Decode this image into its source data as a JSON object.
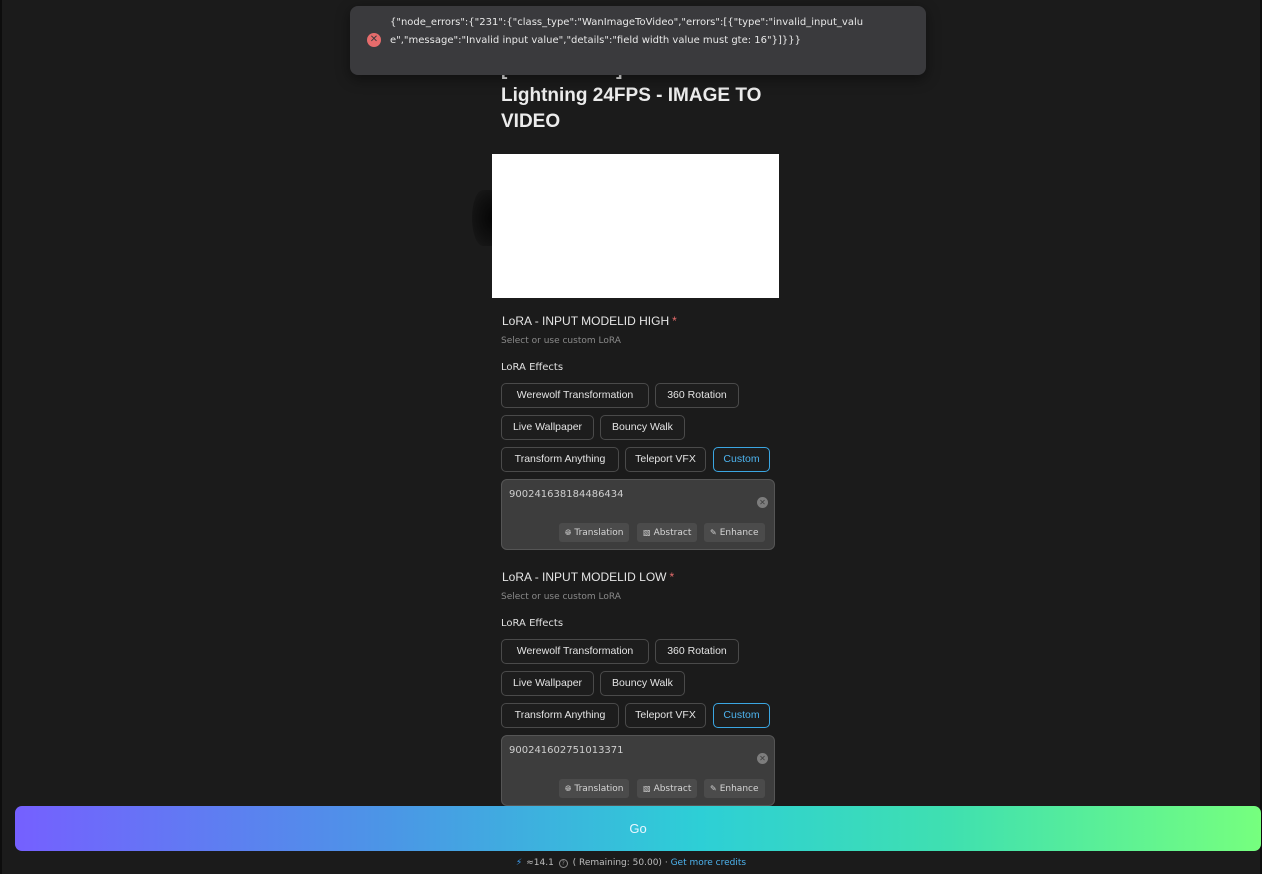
{
  "toast": {
    "icon": "error-circle-icon",
    "message": "{\"node_errors\":{\"231\":{\"class_type\":\"WanImageToVideo\",\"errors\":[{\"type\":\"invalid_input_value\",\"message\":\"Invalid input value\",\"details\":\"field width value must gte: 16\"}]}}}"
  },
  "page": {
    "title": "[FREE USER] WAN2.2 Lightning 24FPS - IMAGE TO VIDEO"
  },
  "lora_high": {
    "title": "LoRA - INPUT MODELID HIGH",
    "required_mark": "*",
    "hint": "Select or use custom LoRA",
    "effects_label": "LoRA Effects",
    "chips": [
      "Werewolf Transformation",
      "360 Rotation",
      "Live Wallpaper",
      "Bouncy Walk",
      "Transform Anything",
      "Teleport VFX",
      "Custom"
    ],
    "active_chip": "Custom",
    "value": "900241638184486434",
    "tools": [
      "Translation",
      "Abstract",
      "Enhance"
    ]
  },
  "lora_low": {
    "title": "LoRA - INPUT MODELID LOW",
    "required_mark": "*",
    "hint": "Select or use custom LoRA",
    "effects_label": "LoRA Effects",
    "chips": [
      "Werewolf Transformation",
      "360 Rotation",
      "Live Wallpaper",
      "Bouncy Walk",
      "Transform Anything",
      "Teleport VFX",
      "Custom"
    ],
    "active_chip": "Custom",
    "value": "900241602751013371",
    "tools": [
      "Translation",
      "Abstract",
      "Enhance"
    ]
  },
  "go_button": {
    "label": "Go"
  },
  "credits": {
    "cost": "≈14.1",
    "remaining": "( Remaining: 50.00)",
    "separator": "·",
    "link": "Get more credits"
  },
  "colors": {
    "background": "#1b1b1b",
    "accent": "#4db3ee",
    "error": "#e66c6c",
    "gradient_start": "#7560ff",
    "gradient_end": "#76ff7e"
  }
}
